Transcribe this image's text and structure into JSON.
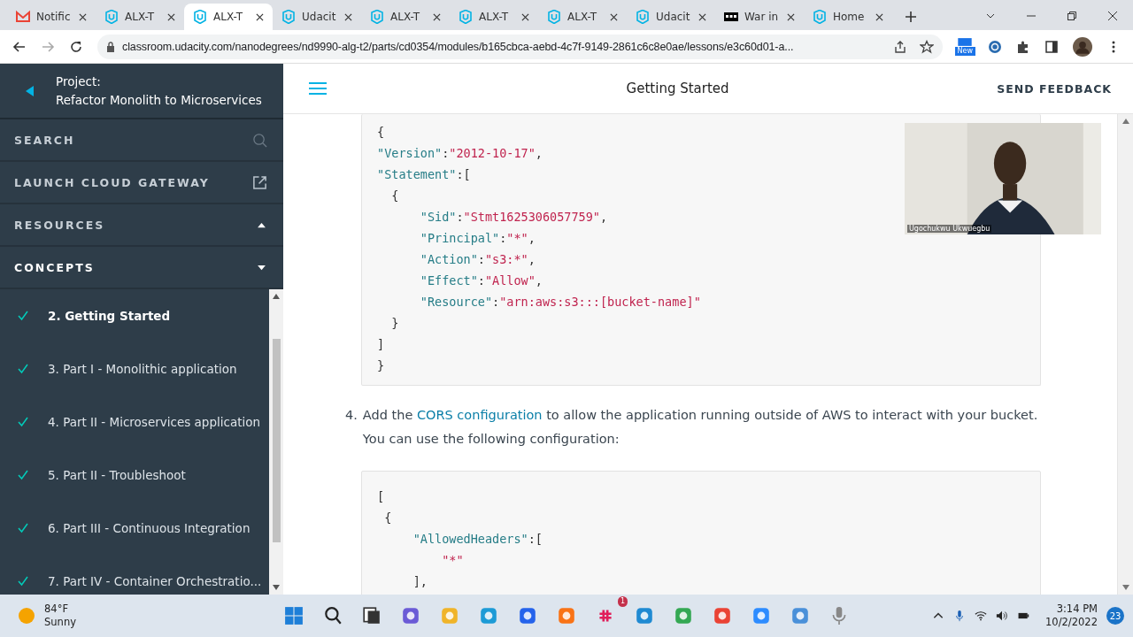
{
  "browser": {
    "tabs": [
      {
        "kind": "gmail",
        "title": "Notific",
        "selected": false
      },
      {
        "kind": "udacity",
        "title": "ALX-T",
        "selected": false
      },
      {
        "kind": "udacity",
        "title": "ALX-T",
        "selected": true
      },
      {
        "kind": "udacity",
        "title": "Udacit",
        "selected": false
      },
      {
        "kind": "udacity",
        "title": "ALX-T",
        "selected": false
      },
      {
        "kind": "udacity",
        "title": "ALX-T",
        "selected": false
      },
      {
        "kind": "udacity",
        "title": "ALX-T",
        "selected": false
      },
      {
        "kind": "udacity",
        "title": "Udacit",
        "selected": false
      },
      {
        "kind": "bars",
        "title": "War in",
        "selected": false
      },
      {
        "kind": "udacity",
        "title": "Home",
        "selected": false
      }
    ],
    "url": "classroom.udacity.com/nanodegrees/nd9990-alg-t2/parts/cd0354/modules/b165cbca-aebd-4c7f-9149-2861c6c8e0ae/lessons/e3c60d01-a...",
    "extension_badge": "New"
  },
  "sidebar": {
    "project_label": "Project:",
    "project_title": "Refactor Monolith to Microservices",
    "menu": [
      {
        "label": "SEARCH",
        "kind": "search"
      },
      {
        "label": "LAUNCH CLOUD GATEWAY",
        "kind": "external"
      },
      {
        "label": "RESOURCES",
        "kind": "section",
        "expanded": false
      },
      {
        "label": "CONCEPTS",
        "kind": "section",
        "expanded": true
      }
    ],
    "concepts": [
      {
        "title": "2. Getting Started",
        "completed": true,
        "selected": true
      },
      {
        "title": "3. Part I - Monolithic application",
        "completed": true,
        "selected": false
      },
      {
        "title": "4. Part II - Microservices application",
        "completed": true,
        "selected": false
      },
      {
        "title": "5. Part II - Troubleshoot",
        "completed": true,
        "selected": false
      },
      {
        "title": "6. Part III - Continuous Integration",
        "completed": true,
        "selected": false
      },
      {
        "title": "7. Part IV - Container Orchestratio...",
        "completed": true,
        "selected": false
      }
    ]
  },
  "header": {
    "title": "Getting Started",
    "feedback": "SEND FEEDBACK"
  },
  "content": {
    "code_block_1": [
      [
        {
          "kind": "punct",
          "text": "{"
        }
      ],
      [
        {
          "kind": "key",
          "text": "\"Version\""
        },
        {
          "kind": "punct",
          "text": ":"
        },
        {
          "kind": "string",
          "text": "\"2012-10-17\""
        },
        {
          "kind": "punct",
          "text": ","
        }
      ],
      [
        {
          "kind": "key",
          "text": "\"Statement\""
        },
        {
          "kind": "punct",
          "text": ":["
        }
      ],
      [
        {
          "kind": "punct",
          "text": "  {"
        }
      ],
      [
        {
          "kind": "key",
          "text": "      \"Sid\""
        },
        {
          "kind": "punct",
          "text": ":"
        },
        {
          "kind": "string",
          "text": "\"Stmt1625306057759\""
        },
        {
          "kind": "punct",
          "text": ","
        }
      ],
      [
        {
          "kind": "key",
          "text": "      \"Principal\""
        },
        {
          "kind": "punct",
          "text": ":"
        },
        {
          "kind": "string",
          "text": "\"*\""
        },
        {
          "kind": "punct",
          "text": ","
        }
      ],
      [
        {
          "kind": "key",
          "text": "      \"Action\""
        },
        {
          "kind": "punct",
          "text": ":"
        },
        {
          "kind": "string",
          "text": "\"s3:*\""
        },
        {
          "kind": "punct",
          "text": ","
        }
      ],
      [
        {
          "kind": "key",
          "text": "      \"Effect\""
        },
        {
          "kind": "punct",
          "text": ":"
        },
        {
          "kind": "string",
          "text": "\"Allow\""
        },
        {
          "kind": "punct",
          "text": ","
        }
      ],
      [
        {
          "kind": "key",
          "text": "      \"Resource\""
        },
        {
          "kind": "punct",
          "text": ":"
        },
        {
          "kind": "string",
          "text": "\"arn:aws:s3:::[bucket-name]\""
        }
      ],
      [
        {
          "kind": "punct",
          "text": "  }"
        }
      ],
      [
        {
          "kind": "punct",
          "text": "]"
        }
      ],
      [
        {
          "kind": "punct",
          "text": "}"
        }
      ]
    ],
    "step": {
      "number": "4.",
      "before": "Add the ",
      "link": "CORS configuration",
      "after": " to allow the application running outside of AWS to interact with your bucket. You can use the following configuration:"
    },
    "code_block_2": [
      [
        {
          "kind": "punct",
          "text": "["
        }
      ],
      [
        {
          "kind": "punct",
          "text": " {"
        }
      ],
      [
        {
          "kind": "key",
          "text": "     \"AllowedHeaders\""
        },
        {
          "kind": "punct",
          "text": ":["
        }
      ],
      [
        {
          "kind": "string",
          "text": "         \"*\""
        }
      ],
      [
        {
          "kind": "punct",
          "text": "     ],"
        }
      ]
    ]
  },
  "video": {
    "kind": "picture",
    "caption": "Ugochukwu Ukwuegbu"
  },
  "taskbar": {
    "temperature": "84°F",
    "weather": "Sunny",
    "slack_badge": "1",
    "time": "3:14 PM",
    "date": "10/2/2022",
    "notifications": "23"
  }
}
